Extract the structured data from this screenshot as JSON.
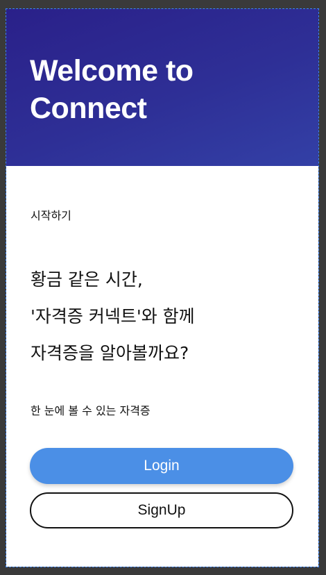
{
  "hero": {
    "title_line1": "Welcome to",
    "title_line2": "Connect"
  },
  "intro": {
    "start_label": "시작하기",
    "headline": [
      "황금 같은 시간,",
      "'자격증 커넥트'와 함께",
      "자격증을 알아볼까요?"
    ],
    "subtext": "한 눈에 볼 수 있는 자격증"
  },
  "actions": {
    "login_label": "Login",
    "signup_label": "SignUp"
  },
  "colors": {
    "hero_gradient_start": "#2a2089",
    "hero_gradient_end": "#3340a6",
    "login_button": "#4b8fe6",
    "signup_border": "#111111"
  }
}
